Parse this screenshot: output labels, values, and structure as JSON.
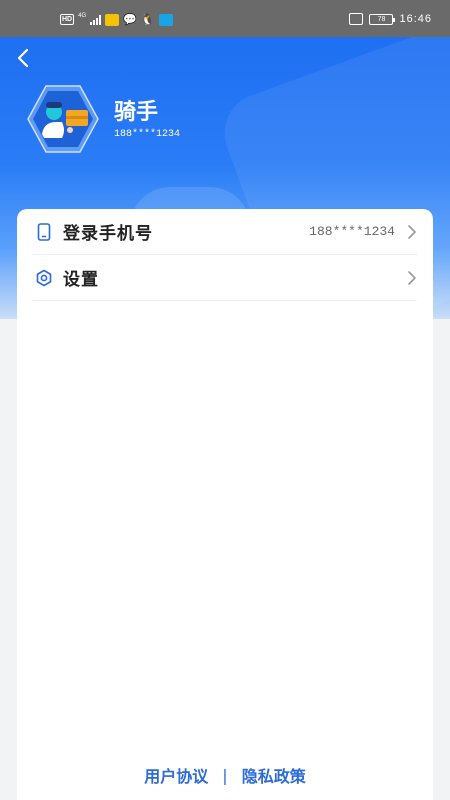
{
  "status_bar": {
    "hd": "HD",
    "network": "4G",
    "battery": "78",
    "time": "16:46"
  },
  "header": {
    "back_icon": "chevron-left-icon",
    "avatar_icon": "delivery-rider-avatar",
    "user_name": "骑手",
    "user_phone": "188****1234"
  },
  "menu": {
    "items": [
      {
        "icon": "phone-icon",
        "label": "登录手机号",
        "value": "188****1234",
        "arrow": "chevron-right-icon"
      },
      {
        "icon": "gear-icon",
        "label": "设置",
        "value": "",
        "arrow": "chevron-right-icon"
      }
    ]
  },
  "footer": {
    "user_agreement": "用户协议",
    "separator": "|",
    "privacy_policy": "隐私政策"
  },
  "colors": {
    "brand_blue": "#1f6ff2",
    "link_blue": "#2d6bd8",
    "status_bar_bg": "#6a6a6a",
    "page_bg": "#f2f3f5"
  }
}
